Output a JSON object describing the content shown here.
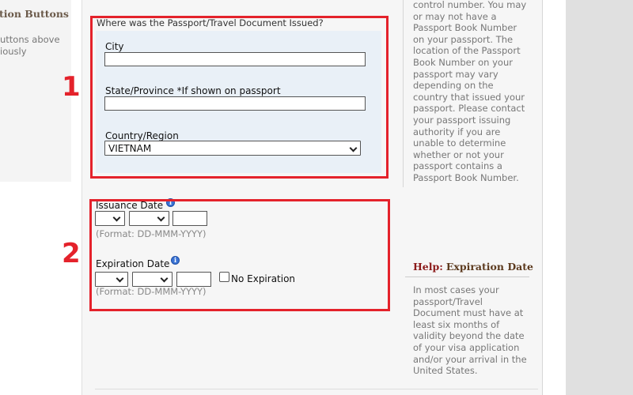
{
  "left_panel": {
    "title": "tion Buttons",
    "lines": [
      "uttons above",
      "iously"
    ]
  },
  "issuance": {
    "heading": "Where was the Passport/Travel Document Issued?",
    "city_label": "City",
    "city_value": "",
    "state_label": "State/Province *If shown on passport",
    "state_value": "",
    "country_label": "Country/Region",
    "country_value": "VIETNAM"
  },
  "dates": {
    "issuance_label": "Issuance Date",
    "issuance_day": "",
    "issuance_month": "",
    "issuance_year": "",
    "issuance_format": "(Format: DD-MMM-YYYY)",
    "expiration_label": "Expiration Date",
    "expiration_day": "",
    "expiration_month": "",
    "expiration_year": "",
    "no_expiration_label": "No Expiration",
    "expiration_format": "(Format: DD-MMM-YYYY)"
  },
  "annotations": {
    "section_1": "1",
    "section_2": "2",
    "highlight_color": "#e4222b"
  },
  "help_top": {
    "text": "control number. You may\nor may not have a\nPassport Book Number\non your passport. The\nlocation of the Passport\nBook Number on your\npassport may vary\ndepending on the\ncountry that issued your\npassport. Please contact\nyour passport issuing\nauthority if you are\nunable to determine\nwhether or not your\npassport contains a\nPassport Book Number."
  },
  "help_expiration": {
    "prefix": "Help:",
    "title": "Expiration Date",
    "text": "In most cases your\npassport/Travel\nDocument must have at\nleast six months of\nvalidity beyond the date\nof your visa application\nand/or your arrival in the\nUnited States."
  },
  "icons": {
    "info": "info-icon",
    "dropdown": "chevron-down-icon"
  }
}
